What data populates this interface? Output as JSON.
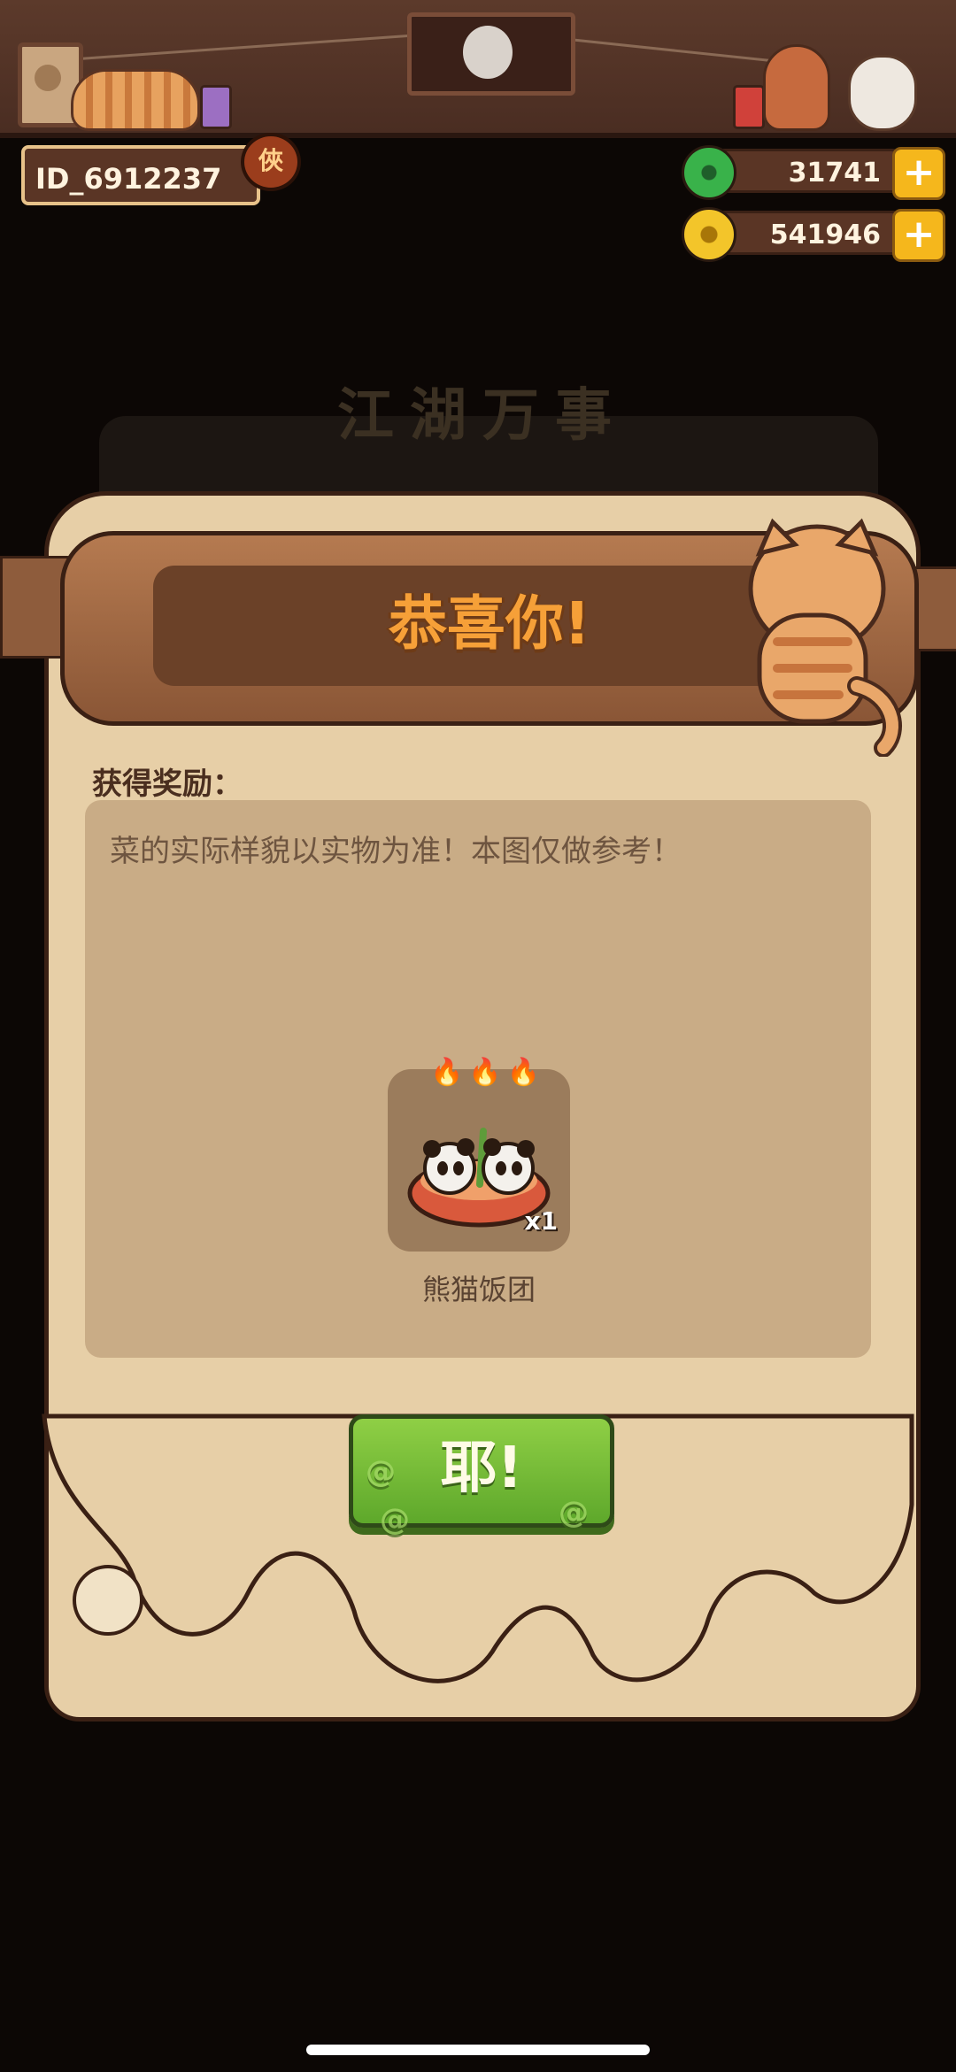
{
  "user": {
    "id": "ID_6912237",
    "badge": "俠"
  },
  "currencies": [
    {
      "name": "jade",
      "icon": "jade-coin-icon",
      "value": "31741",
      "add": "+"
    },
    {
      "name": "gold",
      "icon": "gold-coin-icon",
      "value": "541946",
      "add": "+"
    }
  ],
  "background": {
    "title": "江湖万事"
  },
  "modal": {
    "title": "恭喜你!",
    "reward_label": "获得奖励：",
    "notice": "菜的实际样貌以实物为准！本图仅做参考！",
    "reward": {
      "name": "熊猫饭团",
      "quantity": "x1",
      "icon": "panda-rice-ball-icon",
      "flames": "🔥🔥🔥"
    },
    "confirm_label": "耶!"
  },
  "colors": {
    "accent": "#f6a038",
    "button": "#6bb533",
    "parchment": "#e7cfa7"
  }
}
